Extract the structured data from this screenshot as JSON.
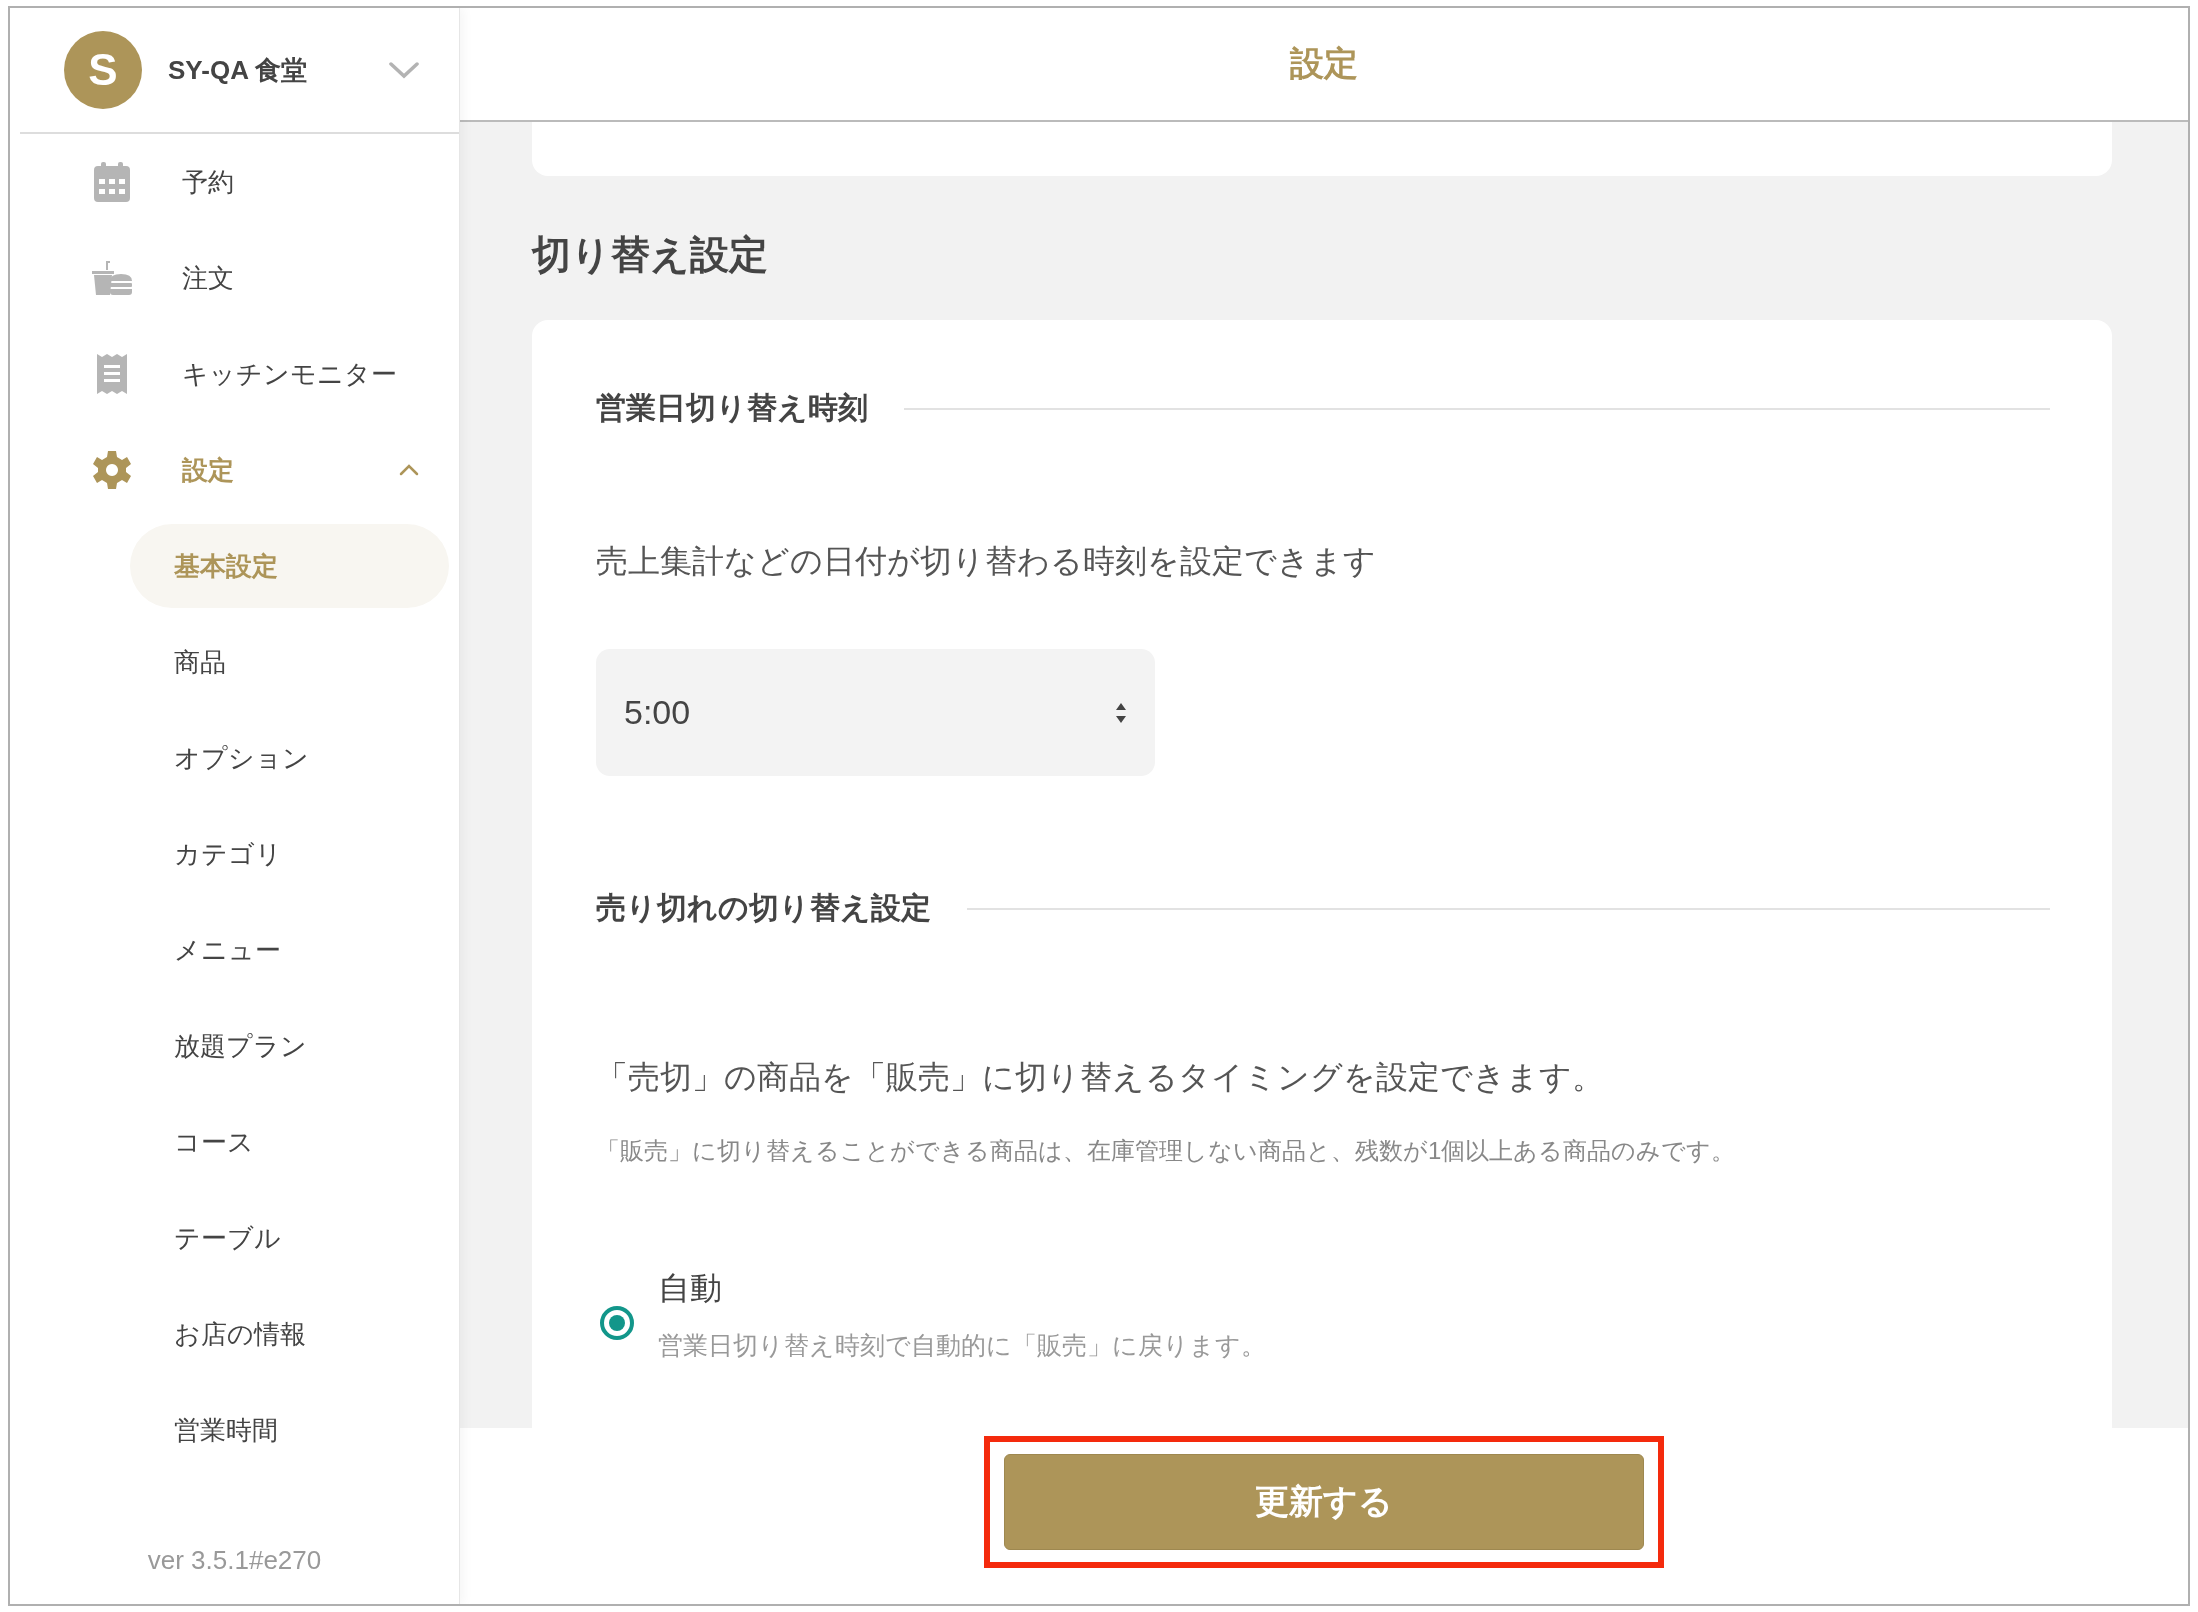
{
  "store": {
    "avatar_letter": "S",
    "name": "SY-QA 食堂"
  },
  "sidebar": {
    "items": [
      {
        "label": "予約",
        "selected": false
      },
      {
        "label": "注文",
        "selected": false
      },
      {
        "label": "キッチンモニター",
        "selected": false
      },
      {
        "label": "設定",
        "selected": true,
        "expanded": true,
        "children": [
          {
            "label": "基本設定",
            "selected": true
          },
          {
            "label": "商品",
            "selected": false
          },
          {
            "label": "オプション",
            "selected": false
          },
          {
            "label": "カテゴリ",
            "selected": false
          },
          {
            "label": "メニュー",
            "selected": false
          },
          {
            "label": "放題プラン",
            "selected": false
          },
          {
            "label": "コース",
            "selected": false
          },
          {
            "label": "テーブル",
            "selected": false
          },
          {
            "label": "お店の情報",
            "selected": false
          },
          {
            "label": "営業時間",
            "selected": false
          }
        ]
      }
    ],
    "version": "ver 3.5.1#e270"
  },
  "header": {
    "title": "設定"
  },
  "section": {
    "title": "切り替え設定",
    "business_day": {
      "heading": "営業日切り替え時刻",
      "description": "売上集計などの日付が切り替わる時刻を設定できます",
      "time_value": "5:00"
    },
    "sold_out": {
      "heading": "売り切れの切り替え設定",
      "description": "「売切」の商品を「販売」に切り替えるタイミングを設定できます。",
      "note": "「販売」に切り替えることができる商品は、在庫管理しない商品と、残数が1個以上ある商品のみです。",
      "options": [
        {
          "label": "自動",
          "description": "営業日切り替え時刻で自動的に「販売」に戻ります。",
          "selected": true
        }
      ]
    }
  },
  "update_button": {
    "label": "更新する",
    "highlighted": true
  }
}
